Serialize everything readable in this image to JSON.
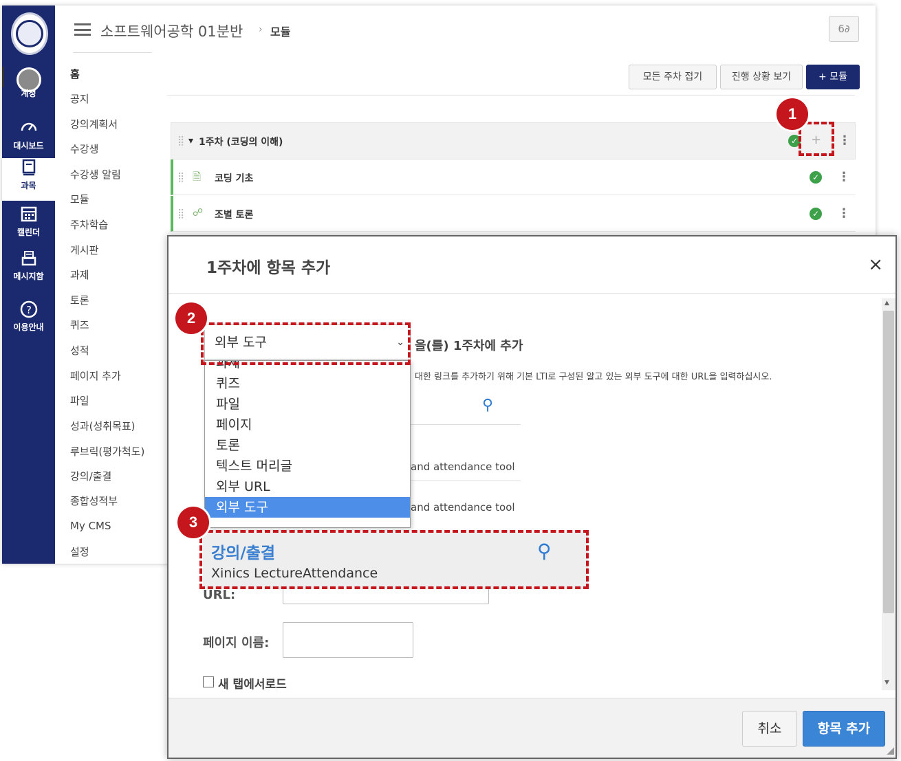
{
  "global_nav": {
    "items": [
      {
        "label": "계정",
        "icon": "user-circle-icon"
      },
      {
        "label": "대시보드",
        "icon": "dashboard-gauge-icon"
      },
      {
        "label": "과목",
        "icon": "book-icon"
      },
      {
        "label": "캘린더",
        "icon": "calendar-icon"
      },
      {
        "label": "메시지함",
        "icon": "inbox-icon"
      },
      {
        "label": "이용안내",
        "icon": "help-circle-icon"
      }
    ]
  },
  "header": {
    "course_title": "소프트웨어공학 01분반",
    "page_crumb": "모듈",
    "glasses_label": "6∂"
  },
  "course_nav": {
    "items": [
      "홈",
      "공지",
      "강의계획서",
      "수강생",
      "수강생 알림",
      "모듈",
      "주차학습",
      "게시판",
      "과제",
      "토론",
      "퀴즈",
      "성적",
      "페이지 추가",
      "파일",
      "성과(성취목표)",
      "루브릭(평가척도)",
      "강의/출결",
      "종합성적부",
      "My CMS",
      "설정"
    ]
  },
  "toolbar": {
    "collapse_all": "모든 주차 접기",
    "view_progress": "진행 상황 보기",
    "add_module": "+ 모듈"
  },
  "module": {
    "title": "1주차 (코딩의 이해)",
    "items": [
      {
        "title": "코딩 기초",
        "icon": "page-icon"
      },
      {
        "title": "조별 토론",
        "icon": "discussion-icon"
      }
    ]
  },
  "annotations": [
    "1",
    "2",
    "3"
  ],
  "modal": {
    "title": "1주차에 항목 추가",
    "close": "×",
    "select_value": "외부 도구",
    "add_suffix": "을(를) 1주차에 추가",
    "description": "대한 링크를 추가하기 위해 기본 LTI로 구성된 알고 있는 외부 도구에 대한 URL을 입력하십시오.",
    "tool_rows": [
      "and attendance tool",
      "and attendance tool"
    ],
    "dropdown_options": [
      "과제",
      "퀴즈",
      "파일",
      "페이지",
      "토론",
      "텍스트 머리글",
      "외부 URL",
      "외부 도구"
    ],
    "selected_option_index": 7,
    "tool_card": {
      "title": "강의/출결",
      "subtitle": "Xinics LectureAttendance"
    },
    "url_label": "URL:",
    "page_name_label": "페이지 이름:",
    "new_tab_label": "새 탭에서로드",
    "cancel": "취소",
    "add_item": "항목 추가"
  },
  "colors": {
    "nav_bg": "#1b2a6e",
    "primary_button": "#3a85d6",
    "annotation_red": "#c4161c",
    "selected_option": "#4d8ee8",
    "published_green": "#3da14a"
  }
}
